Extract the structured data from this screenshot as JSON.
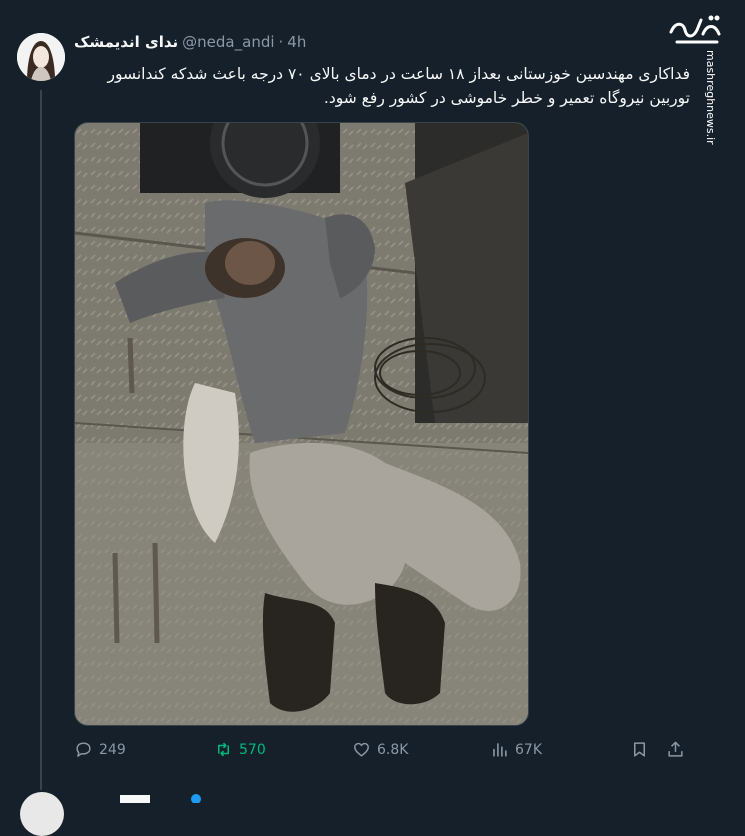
{
  "tweet": {
    "display_name": "ندای اندیمشک",
    "handle": "@neda_andi",
    "separator": "·",
    "time": "4h",
    "text": "فداکاری مهندسین خوزستانی بعداز ۱۸ ساعت در دمای بالای ۷۰ درجه باعث شدکه کندانسور توربین نیروگاه تعمیر و خطر خاموشی در کشور رفع شود.",
    "media_alt": "worker lying on industrial floor"
  },
  "actions": {
    "replies": "249",
    "reposts": "570",
    "likes": "6.8K",
    "views": "67K"
  },
  "watermark": {
    "site": "mashreghnews.ir"
  },
  "colors": {
    "background": "#15202b",
    "repost_active": "#00ba7c",
    "muted": "#8b98a5"
  }
}
